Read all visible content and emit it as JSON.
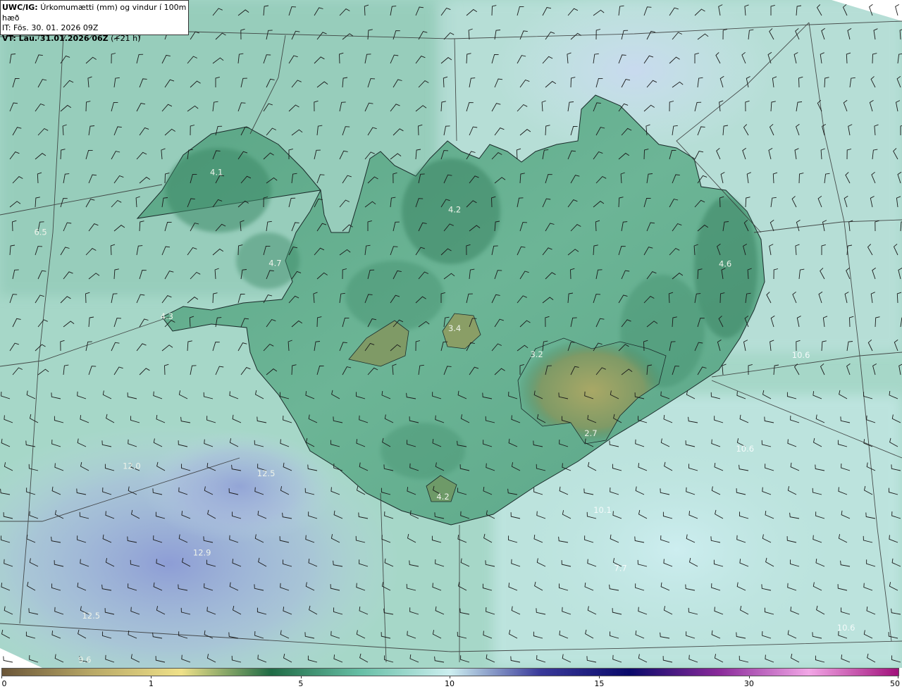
{
  "header": {
    "model": "UWC/IG:",
    "description": "Úrkomumætti (mm) og vindur í 100m hæð",
    "initial_time": "IT: Fös. 30. 01. 2026 09Z",
    "valid_prefix": "VT: Lau. 31.01.2026 06Z",
    "valid_suffix": "(+21 h)"
  },
  "colorbar": {
    "ticks": [
      {
        "value": 0,
        "label": "0"
      },
      {
        "value": 1,
        "label": "1"
      },
      {
        "value": 5,
        "label": "5"
      },
      {
        "value": 10,
        "label": "10"
      },
      {
        "value": 15,
        "label": "15"
      },
      {
        "value": 30,
        "label": "30"
      },
      {
        "value": 50,
        "label": "50"
      }
    ],
    "colors": [
      "#6b5638",
      "#b8a866",
      "#efe189",
      "#1f6b45",
      "#67bfa6",
      "#cdeff0",
      "#3a3a9a",
      "#0a0a6a",
      "#8a2a9a",
      "#f2a6e6",
      "#a0107a"
    ]
  },
  "map_labels": [
    {
      "text": "4.1",
      "fx": 0.24,
      "fy": 0.262,
      "tone": "light"
    },
    {
      "text": "6.5",
      "fx": 0.045,
      "fy": 0.352,
      "tone": "light"
    },
    {
      "text": "4.7",
      "fx": 0.305,
      "fy": 0.398,
      "tone": "light"
    },
    {
      "text": "4.3",
      "fx": 0.185,
      "fy": 0.478,
      "tone": "light"
    },
    {
      "text": "4.2",
      "fx": 0.504,
      "fy": 0.318,
      "tone": "light"
    },
    {
      "text": "3.4",
      "fx": 0.504,
      "fy": 0.496,
      "tone": "light"
    },
    {
      "text": "3.2",
      "fx": 0.595,
      "fy": 0.535,
      "tone": "light"
    },
    {
      "text": "4.6",
      "fx": 0.804,
      "fy": 0.399,
      "tone": "light"
    },
    {
      "text": "10.6",
      "fx": 0.888,
      "fy": 0.536,
      "tone": "white"
    },
    {
      "text": "2.7",
      "fx": 0.655,
      "fy": 0.653,
      "tone": "light"
    },
    {
      "text": "10.6",
      "fx": 0.826,
      "fy": 0.676,
      "tone": "white"
    },
    {
      "text": "12.0",
      "fx": 0.146,
      "fy": 0.702,
      "tone": "light"
    },
    {
      "text": "12.5",
      "fx": 0.295,
      "fy": 0.713,
      "tone": "light"
    },
    {
      "text": "4.2",
      "fx": 0.491,
      "fy": 0.748,
      "tone": "light"
    },
    {
      "text": "10.1",
      "fx": 0.668,
      "fy": 0.768,
      "tone": "white"
    },
    {
      "text": "12.9",
      "fx": 0.224,
      "fy": 0.832,
      "tone": "light"
    },
    {
      "text": "7.7",
      "fx": 0.688,
      "fy": 0.855,
      "tone": "white"
    },
    {
      "text": "12.5",
      "fx": 0.101,
      "fy": 0.926,
      "tone": "light"
    },
    {
      "text": "10.6",
      "fx": 0.938,
      "fy": 0.944,
      "tone": "white"
    },
    {
      "text": "9.6",
      "fx": 0.094,
      "fy": 0.992,
      "tone": "light"
    }
  ]
}
